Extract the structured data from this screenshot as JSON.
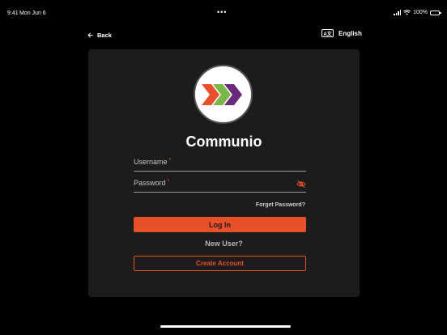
{
  "status_bar": {
    "time": "9:41",
    "date": "Mon Jun 6",
    "dots": "•••",
    "battery": "100%"
  },
  "nav": {
    "back_label": "Back",
    "language_icon_text": "A文",
    "language_label": "English"
  },
  "login": {
    "app_name": "Communio",
    "username_label": "Username",
    "password_label": "Password",
    "required_mark": "*",
    "forgot_password": "Forget Password?",
    "login_button": "Log In",
    "new_user": "New User?",
    "create_account": "Create Account"
  },
  "colors": {
    "accent": "#e8502a",
    "card_background": "#1c1c1c",
    "background": "#000000",
    "logo_orange": "#e8502a",
    "logo_green": "#7ab648",
    "logo_purple": "#6a2a7a"
  },
  "icons": {
    "back": "arrow-left-icon",
    "language": "translate-icon",
    "password_visibility": "eye-off-icon"
  }
}
